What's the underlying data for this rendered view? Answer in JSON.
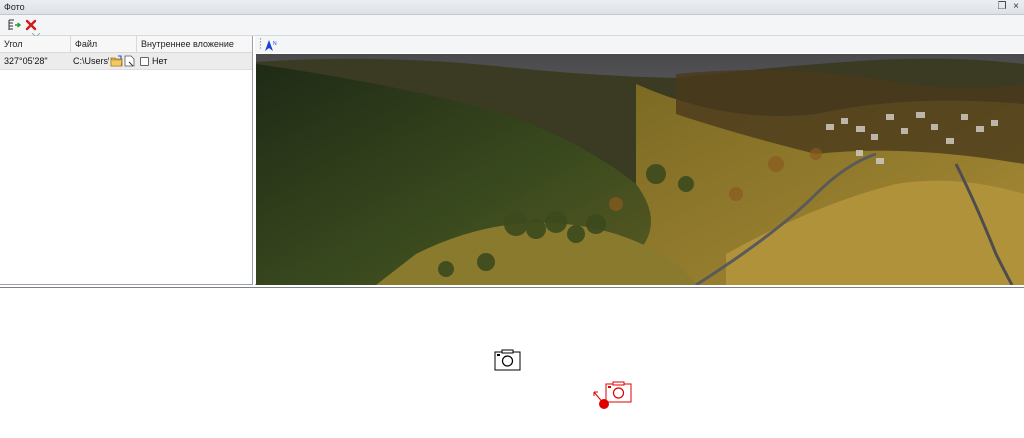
{
  "window": {
    "title": "Фото"
  },
  "toolbar": {
    "add_icon": "add-photo-icon",
    "delete_icon": "delete-x-icon"
  },
  "table": {
    "columns": [
      "Угол",
      "Файл",
      "Внутреннее вложение"
    ],
    "rows": [
      {
        "angle": "327°05'28\"",
        "file": "C:\\Users\\",
        "embedded": "Нет"
      }
    ]
  },
  "image_toolbar": {
    "north_icon": "north-arrow-icon"
  },
  "map": {
    "markers": [
      {
        "type": "camera",
        "color": "#000000"
      },
      {
        "type": "camera-selected",
        "color": "#e00000"
      }
    ]
  },
  "colors": {
    "accent_red": "#e00000",
    "north_blue": "#1a3fd6"
  }
}
